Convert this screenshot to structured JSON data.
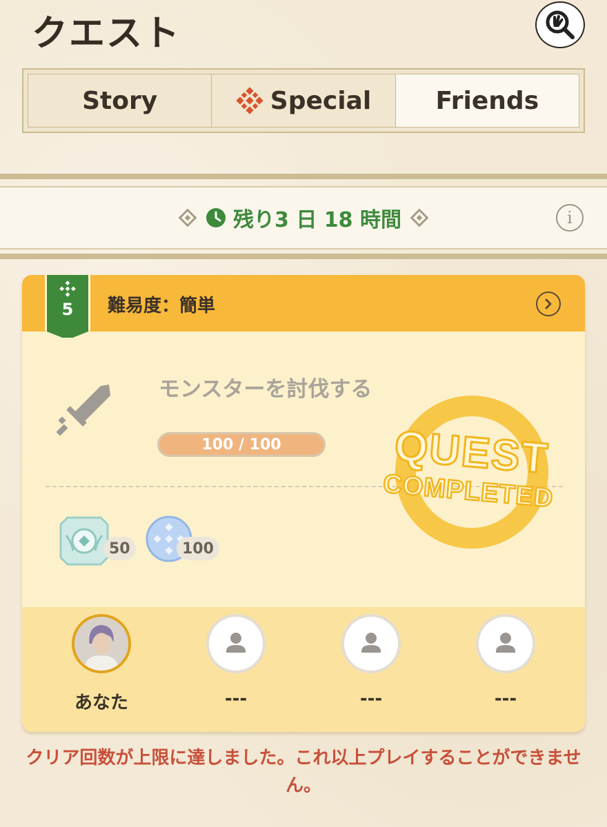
{
  "header": {
    "title": "クエスト",
    "search_icon": "search-hand-icon"
  },
  "tabs": [
    {
      "label": "Story",
      "icon": null,
      "active": false
    },
    {
      "label": "Special",
      "icon": "special-emblem-icon",
      "active": false
    },
    {
      "label": "Friends",
      "icon": null,
      "active": true
    }
  ],
  "timer": {
    "text": "残り3 日 18 時間",
    "icon": "clock-icon"
  },
  "quest": {
    "level": "5",
    "difficulty": "難易度：簡単",
    "name": "モンスターを討伐する",
    "progress_text": "100 / 100",
    "progress_fraction": 1.0,
    "status_stamp": "QUEST COMPLETED",
    "rewards": [
      {
        "icon": "crest-gem-icon",
        "count": "50"
      },
      {
        "icon": "blue-orb-icon",
        "count": "100"
      }
    ],
    "members": [
      {
        "name": "あなた",
        "is_self": true
      },
      {
        "name": "---",
        "is_self": false
      },
      {
        "name": "---",
        "is_self": false
      },
      {
        "name": "---",
        "is_self": false
      }
    ]
  },
  "notice": "クリア回数が上限に達しました。これ以上プレイすることができません。",
  "colors": {
    "accent_green": "#3d8a3c",
    "header_orange": "#f8b83a",
    "notice_red": "#c8503a",
    "stamp_yellow": "#f6c23a"
  }
}
